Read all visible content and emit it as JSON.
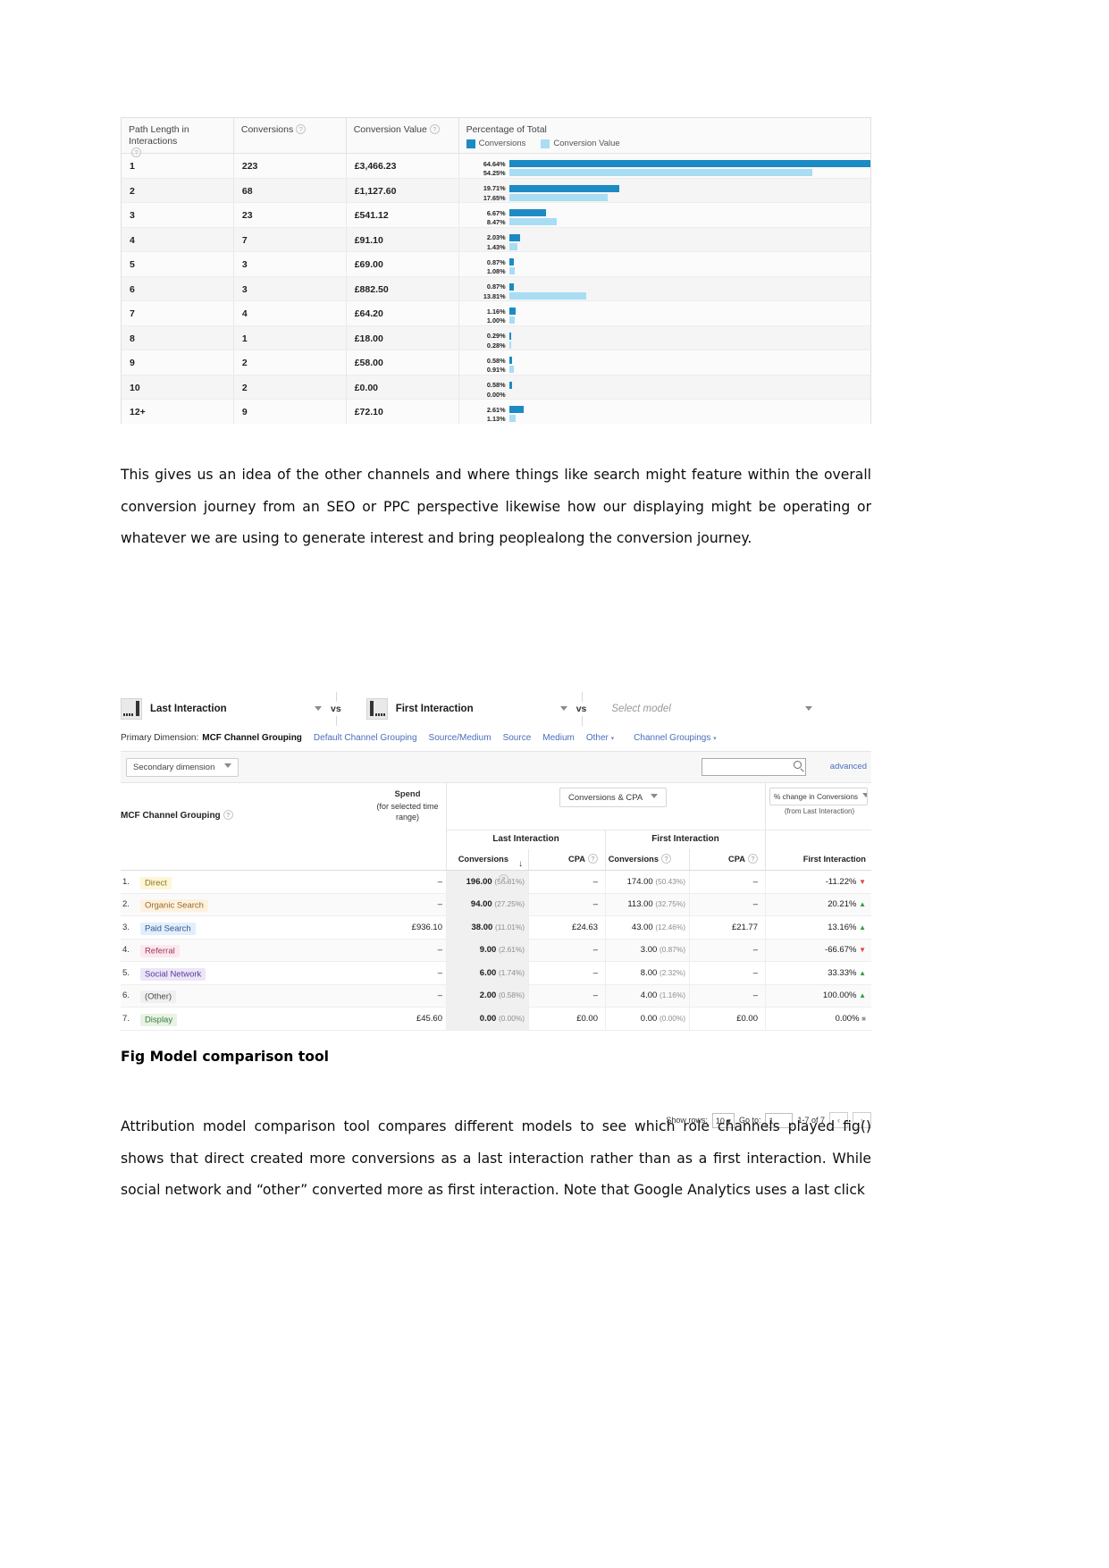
{
  "figure1": {
    "name": "path-length-in-interactions-report",
    "columns": [
      "Path Length in Interactions",
      "Conversions",
      "Conversion Value",
      "Percentage of Total"
    ],
    "legend": [
      {
        "label": "Conversions",
        "color": "#1c8bc4"
      },
      {
        "label": "Conversion Value",
        "color": "#a8ddf3"
      }
    ],
    "rows": [
      {
        "path_length": "1",
        "conversions": "223",
        "conversion_value": "£3,466.23",
        "pct_conversions": "64.64%",
        "pct_value": "54.25%"
      },
      {
        "path_length": "2",
        "conversions": "68",
        "conversion_value": "£1,127.60",
        "pct_conversions": "19.71%",
        "pct_value": "17.65%"
      },
      {
        "path_length": "3",
        "conversions": "23",
        "conversion_value": "£541.12",
        "pct_conversions": "6.67%",
        "pct_value": "8.47%"
      },
      {
        "path_length": "4",
        "conversions": "7",
        "conversion_value": "£91.10",
        "pct_conversions": "2.03%",
        "pct_value": "1.43%"
      },
      {
        "path_length": "5",
        "conversions": "3",
        "conversion_value": "£69.00",
        "pct_conversions": "0.87%",
        "pct_value": "1.08%"
      },
      {
        "path_length": "6",
        "conversions": "3",
        "conversion_value": "£882.50",
        "pct_conversions": "0.87%",
        "pct_value": "13.81%"
      },
      {
        "path_length": "7",
        "conversions": "4",
        "conversion_value": "£64.20",
        "pct_conversions": "1.16%",
        "pct_value": "1.00%"
      },
      {
        "path_length": "8",
        "conversions": "1",
        "conversion_value": "£18.00",
        "pct_conversions": "0.29%",
        "pct_value": "0.28%"
      },
      {
        "path_length": "9",
        "conversions": "2",
        "conversion_value": "£58.00",
        "pct_conversions": "0.58%",
        "pct_value": "0.91%"
      },
      {
        "path_length": "10",
        "conversions": "2",
        "conversion_value": "£0.00",
        "pct_conversions": "0.58%",
        "pct_value": "0.00%"
      },
      {
        "path_length": "12+",
        "conversions": "9",
        "conversion_value": "£72.10",
        "pct_conversions": "2.61%",
        "pct_value": "1.13%"
      }
    ]
  },
  "chart_data": {
    "type": "bar",
    "title": "Percentage of Total",
    "categories": [
      "1",
      "2",
      "3",
      "4",
      "5",
      "6",
      "7",
      "8",
      "9",
      "10",
      "12+"
    ],
    "xlabel": "Path Length in Interactions",
    "ylabel": "Percentage of Total",
    "ylim": [
      0,
      64.64
    ],
    "grid": false,
    "legend_position": "top",
    "series": [
      {
        "name": "Conversions",
        "color": "#1c8bc4",
        "values": [
          64.64,
          19.71,
          6.67,
          2.03,
          0.87,
          0.87,
          1.16,
          0.29,
          0.58,
          0.58,
          2.61
        ]
      },
      {
        "name": "Conversion Value",
        "color": "#a8ddf3",
        "values": [
          54.25,
          17.65,
          8.47,
          1.43,
          1.08,
          13.81,
          1.0,
          0.28,
          0.91,
          0.0,
          1.13
        ]
      }
    ]
  },
  "paragraph1": "This gives us an idea of the other channels and where things like search might feature within the overall conversion journey from an SEO or PPC perspective likewise how our displaying might be operating or whatever we are using to generate interest and bring peoplealong the conversion journey.",
  "figure_caption": "Fig Model comparison tool",
  "paragraph2": "Attribution model comparison tool compares different models to see which role channels played fig() shows that direct created more conversions as a last interaction rather than as a first interaction. While social network and “other” converted more as first interaction. Note that Google Analytics uses a last click",
  "figure2": {
    "name": "model-comparison-tool",
    "models": [
      {
        "label": "Last Interaction",
        "placeholder": false
      },
      {
        "label": "First Interaction",
        "placeholder": false
      },
      {
        "label": "Select model",
        "placeholder": true
      }
    ],
    "vs_label": "vs",
    "primary_dimension": {
      "label": "Primary Dimension:",
      "selected": "MCF Channel Grouping",
      "links": [
        "Default Channel Grouping",
        "Source/Medium",
        "Source",
        "Medium"
      ],
      "dropdowns": [
        "Other",
        "Channel Groupings"
      ]
    },
    "secondary_dimension_label": "Secondary dimension",
    "search_value": "",
    "search_placeholder": "",
    "advanced_label": "advanced",
    "table": {
      "dimension_header": "MCF Channel Grouping",
      "spend_header_main": "Spend",
      "spend_header_sub": "(for selected time range)",
      "metric_group_button": "Conversions & CPA",
      "change_button": "% change in Conversions",
      "change_sub": "(from Last Interaction)",
      "group_headers": [
        "Last Interaction",
        "First Interaction",
        "First Interaction"
      ],
      "column_headers": [
        "Conversions",
        "CPA",
        "Conversions",
        "CPA",
        "First Interaction"
      ],
      "rows": [
        {
          "index": "1.",
          "channel": "Direct",
          "chip_bg": "#fdf6d8",
          "chip_fg": "#8a7a1a",
          "spend": "–",
          "li_conv": "196.00",
          "li_conv_pct": "(56.81%)",
          "li_cpa": "–",
          "fi_conv": "174.00",
          "fi_conv_pct": "(50.43%)",
          "fi_cpa": "–",
          "change": "-11.22%",
          "dir": "down"
        },
        {
          "index": "2.",
          "channel": "Organic Search",
          "chip_bg": "#fdf1e0",
          "chip_fg": "#9a6a1f",
          "spend": "–",
          "li_conv": "94.00",
          "li_conv_pct": "(27.25%)",
          "li_cpa": "–",
          "fi_conv": "113.00",
          "fi_conv_pct": "(32.75%)",
          "fi_cpa": "–",
          "change": "20.21%",
          "dir": "up"
        },
        {
          "index": "3.",
          "channel": "Paid Search",
          "chip_bg": "#e4eefb",
          "chip_fg": "#2a5a9a",
          "spend": "£936.10",
          "li_conv": "38.00",
          "li_conv_pct": "(11.01%)",
          "li_cpa": "£24.63",
          "fi_conv": "43.00",
          "fi_conv_pct": "(12.46%)",
          "fi_cpa": "£21.77",
          "change": "13.16%",
          "dir": "up"
        },
        {
          "index": "4.",
          "channel": "Referral",
          "chip_bg": "#fce8ee",
          "chip_fg": "#9a3a5a",
          "spend": "–",
          "li_conv": "9.00",
          "li_conv_pct": "(2.61%)",
          "li_cpa": "–",
          "fi_conv": "3.00",
          "fi_conv_pct": "(0.87%)",
          "fi_cpa": "–",
          "change": "-66.67%",
          "dir": "down"
        },
        {
          "index": "5.",
          "channel": "Social Network",
          "chip_bg": "#ece6f7",
          "chip_fg": "#5a3a9a",
          "spend": "–",
          "li_conv": "6.00",
          "li_conv_pct": "(1.74%)",
          "li_cpa": "–",
          "fi_conv": "8.00",
          "fi_conv_pct": "(2.32%)",
          "fi_cpa": "–",
          "change": "33.33%",
          "dir": "up"
        },
        {
          "index": "6.",
          "channel": "(Other)",
          "chip_bg": "#f0f0f0",
          "chip_fg": "#4a4a4a",
          "spend": "–",
          "li_conv": "2.00",
          "li_conv_pct": "(0.58%)",
          "li_cpa": "–",
          "fi_conv": "4.00",
          "fi_conv_pct": "(1.16%)",
          "fi_cpa": "–",
          "change": "100.00%",
          "dir": "up"
        },
        {
          "index": "7.",
          "channel": "Display",
          "chip_bg": "#e8f3e6",
          "chip_fg": "#3a7a3a",
          "spend": "£45.60",
          "li_conv": "0.00",
          "li_conv_pct": "(0.00%)",
          "li_cpa": "£0.00",
          "fi_conv": "0.00",
          "fi_conv_pct": "(0.00%)",
          "fi_cpa": "£0.00",
          "change": "0.00%",
          "dir": "neutral"
        }
      ],
      "footer": {
        "show_rows_label": "Show rows:",
        "show_rows_value": "10",
        "goto_label": "Go to:",
        "goto_value": "1",
        "range_label": "1-7 of 7",
        "prev_icon": "‹",
        "next_icon": "›"
      }
    }
  }
}
